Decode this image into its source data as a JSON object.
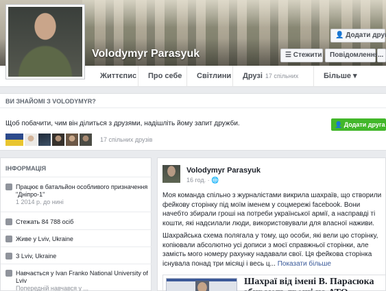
{
  "profile": {
    "name": "Volodymyr Parasyuk"
  },
  "header_buttons": {
    "add_friend": "Додати друга",
    "follow": "Стежити",
    "message": "Повідомлення",
    "more": "..."
  },
  "tabs": {
    "timeline": "Життєпис",
    "about": "Про себе",
    "photos": "Світлини",
    "friends": "Друзі",
    "friends_count": "17 спільних",
    "more": "Більше ▾"
  },
  "mutual": {
    "heading": "ВИ ЗНАЙОМІ З VOLODYMYR?",
    "prompt_before": "Щоб побачити, чим він ділиться з друзями, ",
    "prompt_link": "надішліть йому запит дружби.",
    "count": "17 спільних друзів",
    "add_button": "Додати друга"
  },
  "info": {
    "heading": "ІНФОРМАЦІЯ",
    "rows": [
      {
        "line1": "Працює в батальйон особливого призначення",
        "line2": "\"Дніпро-1\"",
        "line3": "1 2014 р. до нині"
      },
      {
        "line1": "Стежать 84 788 осіб"
      },
      {
        "line1": "Живе у Lviv, Ukraine"
      },
      {
        "line1": "З Lviv, Ukraine"
      },
      {
        "line1": "Навчається у Ivan Franko National University of",
        "line2": "Lviv",
        "line3": "Попередній навчався у ..."
      }
    ]
  },
  "post": {
    "author": "Volodymyr Parasyuk",
    "time": "16 год. · ",
    "para1": "Моя команда спільно з журналістами викрила шахраїв, що створили фейкову сторінку під моїм іменем у соцмережі facebook. Вони начебто збирали гроші на потреби української армії, а насправді ті кошти, які надсилали люди, використовували для власної наживи.",
    "para2": "Шахрайська схема полягала у тому, що особи, які вели цю сторінку, копіювали абсолютно усі дописи з моєї справжньої сторінки, але замість мого номеру рахунку надавали свої. Ця фейкова сторінка існувала понад три місяці і весь ц...",
    "see_more": "Показати більше",
    "link_title": "Шахраї від імені В. Парасюка збирають гроші на АТО"
  },
  "colors": {
    "accent_blue": "#385898",
    "green_button": "#42b72a",
    "page_background": "#e9ebee"
  }
}
